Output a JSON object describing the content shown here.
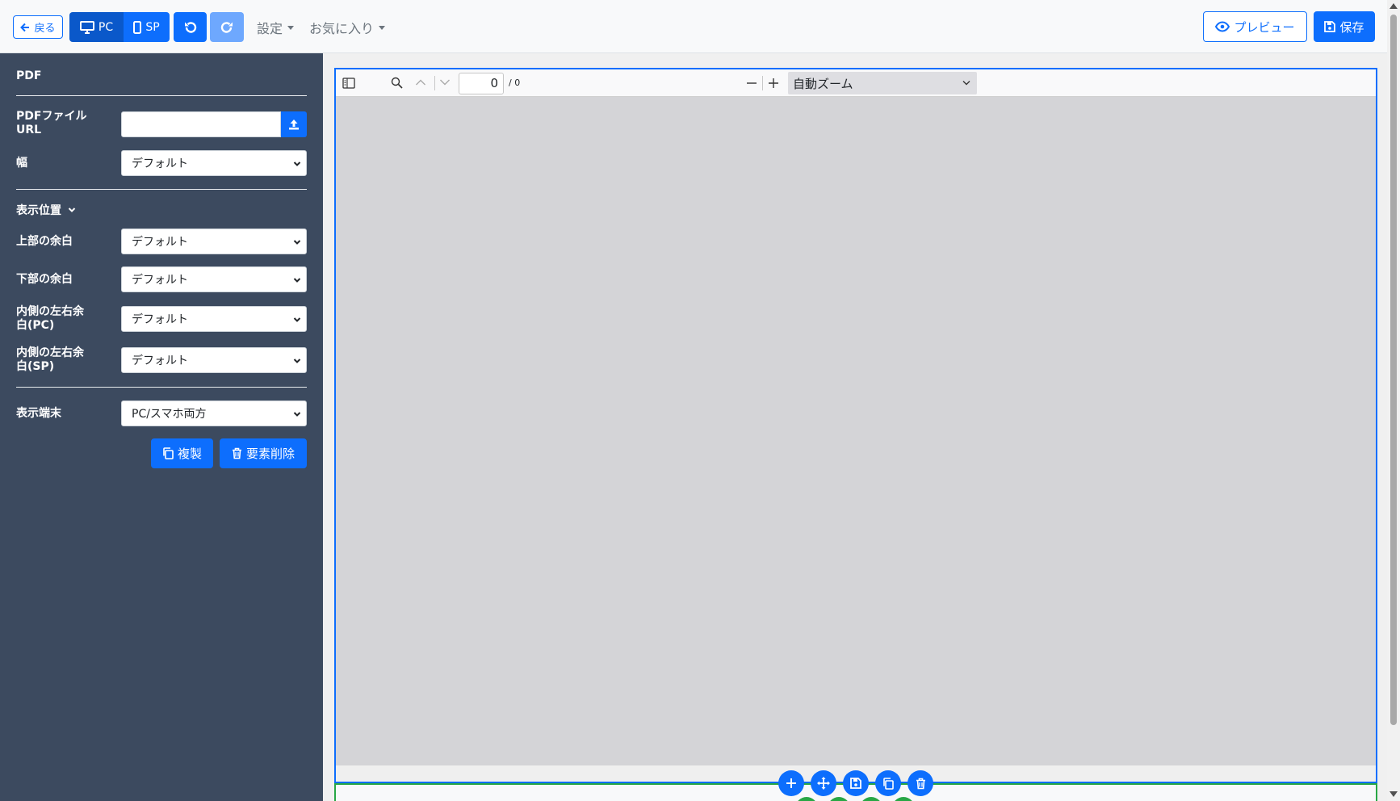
{
  "toolbar": {
    "back_label": "戻る",
    "pc_label": "PC",
    "sp_label": "SP",
    "settings_label": "設定",
    "favorites_label": "お気に入り",
    "preview_label": "プレビュー",
    "save_label": "保存"
  },
  "sidebar": {
    "title": "PDF",
    "pdf_url_label": "PDFファイルURL",
    "width_label": "幅",
    "width_value": "デフォルト",
    "section_label": "表示位置",
    "top_margin_label": "上部の余白",
    "top_margin_value": "デフォルト",
    "bottom_margin_label": "下部の余白",
    "bottom_margin_value": "デフォルト",
    "inner_pc_label": "内側の左右余白(PC)",
    "inner_pc_value": "デフォルト",
    "inner_sp_label": "内側の左右余白(SP)",
    "inner_sp_value": "デフォルト",
    "device_label": "表示端末",
    "device_value": "PC/スマホ両方",
    "duplicate_label": "複製",
    "delete_label": "要素削除"
  },
  "viewer": {
    "page_number": "0",
    "page_total": "/ 0",
    "zoom": "自動ズーム"
  },
  "colors": {
    "primary": "#0d6efd",
    "sidebar_bg": "#3c4a5f",
    "success": "#28a745",
    "viewer_bg": "#d4d4d7"
  }
}
